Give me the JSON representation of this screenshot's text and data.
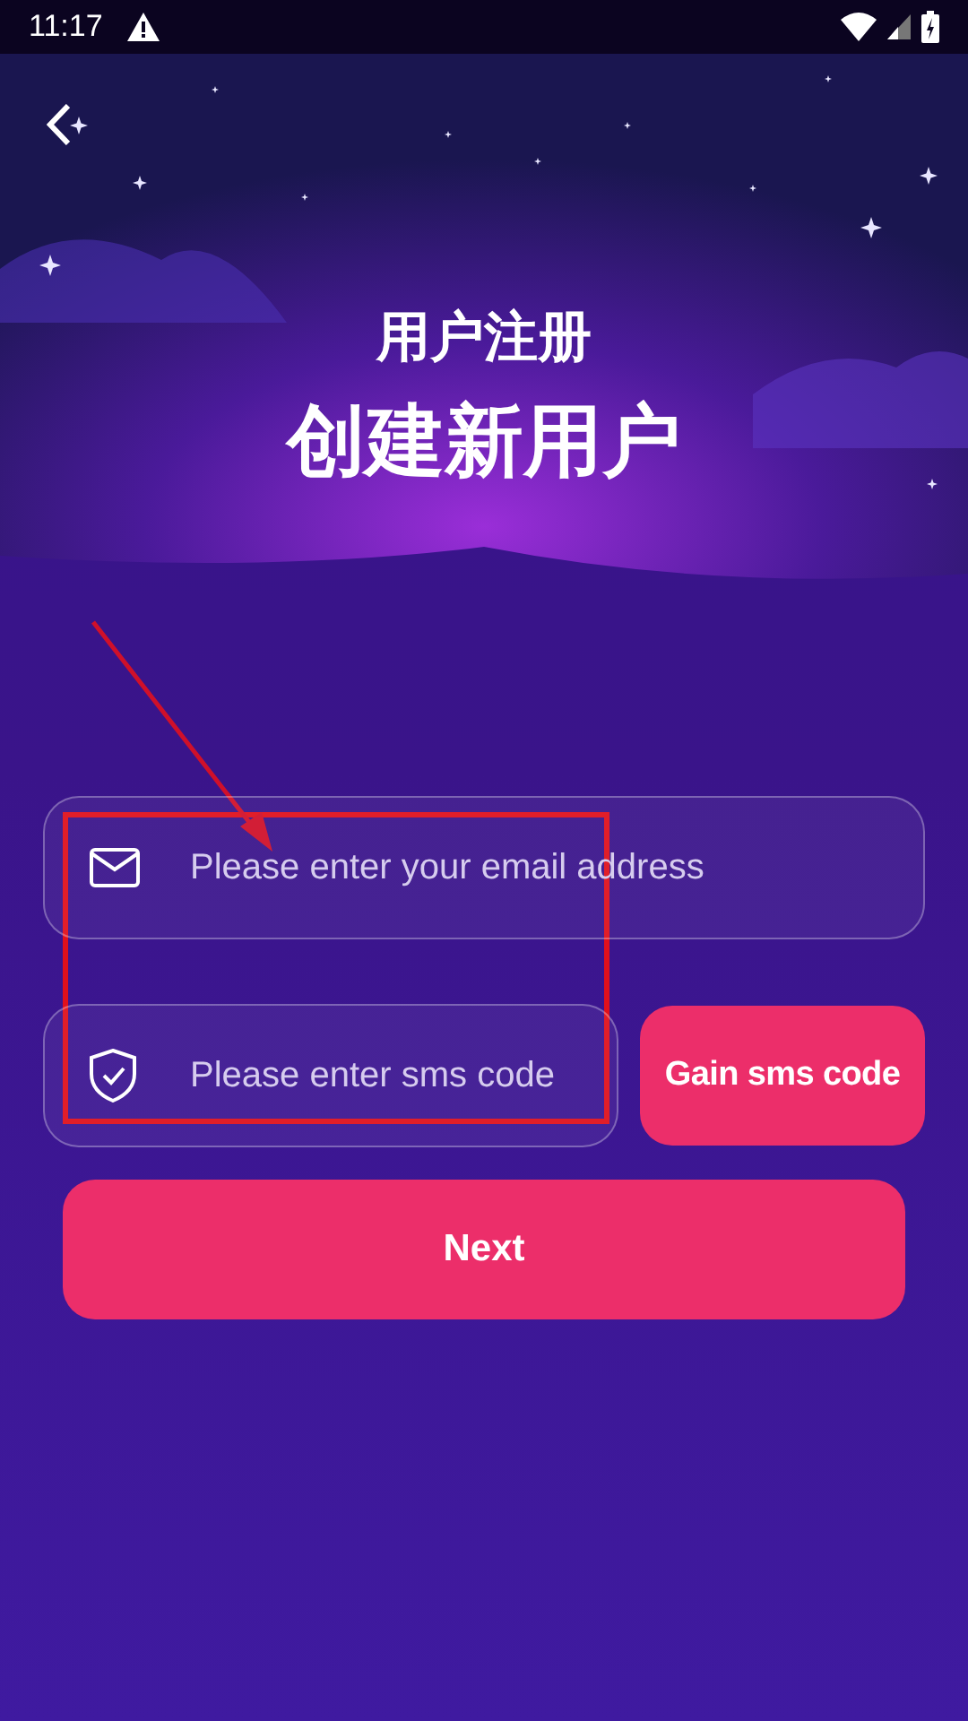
{
  "status_bar": {
    "time": "11:17"
  },
  "header": {
    "subtitle": "用户注册",
    "title": "创建新用户"
  },
  "form": {
    "email": {
      "placeholder": "Please enter your email address"
    },
    "sms": {
      "placeholder": "Please enter sms code"
    },
    "gain_button": "Gain sms code",
    "next_button": "Next"
  }
}
